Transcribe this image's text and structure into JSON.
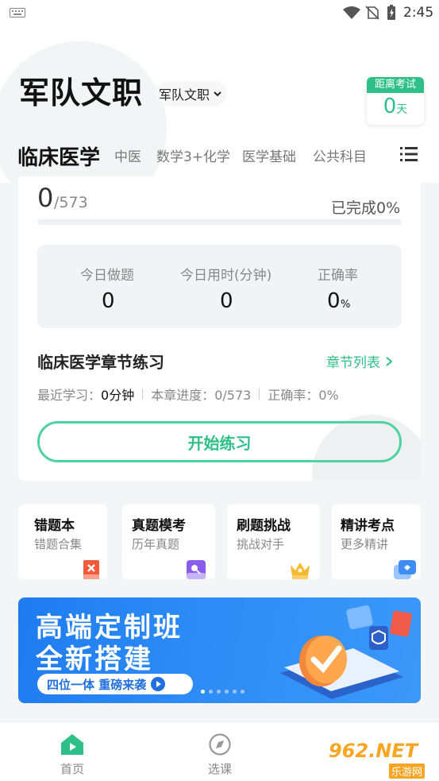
{
  "status": {
    "time": "2:45"
  },
  "header": {
    "title": "军队文职",
    "category_select": "军队文职",
    "exam_countdown_label": "距离考试",
    "exam_countdown_value": "0",
    "exam_countdown_unit": "天"
  },
  "tabs": [
    {
      "label": "临床医学"
    },
    {
      "label": "中医"
    },
    {
      "label": "数学3+化学"
    },
    {
      "label": "医学基础"
    },
    {
      "label": "公共科目"
    }
  ],
  "progress": {
    "done": "0",
    "total": "/573",
    "percent_text": "已完成0%",
    "fraction": 0
  },
  "stats": {
    "today_questions_label": "今日做题",
    "today_questions_value": "0",
    "today_minutes_label": "今日用时(分钟)",
    "today_minutes_value": "0",
    "accuracy_label": "正确率",
    "accuracy_value": "0",
    "accuracy_unit": "%"
  },
  "chapter": {
    "title": "临床医学章节练习",
    "list_link": "章节列表",
    "recent_label": "最近学习：",
    "recent_value": "0分钟",
    "progress_text": "本章进度：0/573",
    "accuracy_text": "正确率：0%",
    "start_button": "开始练习"
  },
  "tools": [
    {
      "title": "错题本",
      "subtitle": "错题合集",
      "icon": "wrong-book-icon",
      "color": "#f25b3a"
    },
    {
      "title": "真题模考",
      "subtitle": "历年真题",
      "icon": "mock-exam-icon",
      "color": "#8a5cf0"
    },
    {
      "title": "刷题挑战",
      "subtitle": "挑战对手",
      "icon": "crown-icon",
      "color": "#f5b82e"
    },
    {
      "title": "精讲考点",
      "subtitle": "更多精讲",
      "icon": "lecture-icon",
      "color": "#3c8ef5"
    }
  ],
  "banner": {
    "line1": "高端定制班",
    "line2": "全新搭建",
    "tagline": "四位一体 重磅来袭"
  },
  "bottom_nav": [
    {
      "label": "首页",
      "icon": "home-icon",
      "active": true
    },
    {
      "label": "选课",
      "icon": "compass-icon",
      "active": false
    }
  ],
  "watermark": {
    "text": "962.NET",
    "sub": "乐游网"
  },
  "colors": {
    "accent": "#2fc08a",
    "accent_border": "#4ed3a0",
    "banner": "#2d8cf6"
  }
}
